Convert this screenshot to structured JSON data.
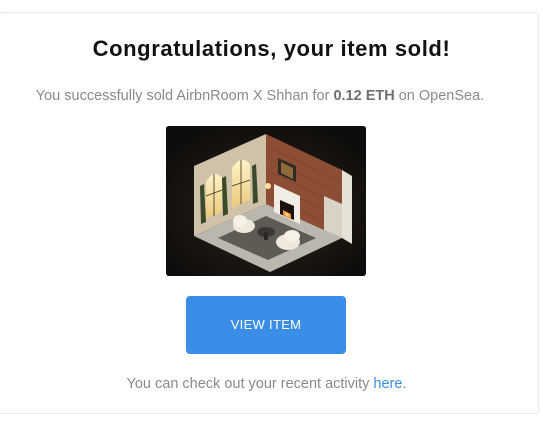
{
  "email": {
    "title": "Congratulations, your item sold!",
    "subtitle": {
      "prefix": "You successfully sold AirbnRoom X Shhan for ",
      "price": "0.12 ETH",
      "suffix": " on OpenSea."
    },
    "image_alt": "isometric-room-artwork",
    "button_label": "VIEW ITEM",
    "footer": {
      "text": "You can check out your recent activity ",
      "link_label": "here",
      "suffix": "."
    }
  },
  "colors": {
    "accent": "#3b8ee8",
    "title": "#111111",
    "body_text": "#8a8a8a"
  }
}
